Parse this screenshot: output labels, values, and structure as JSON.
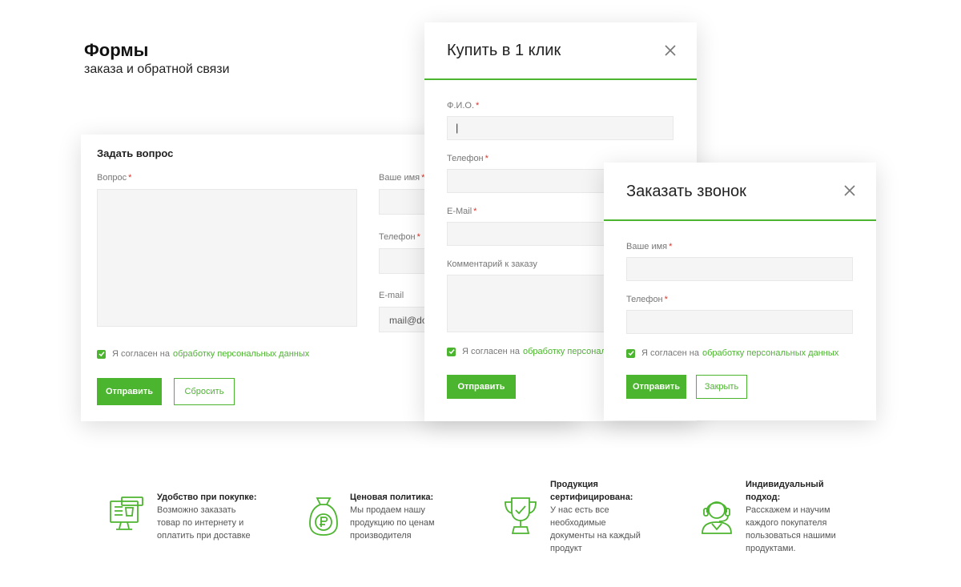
{
  "page": {
    "title": "Формы",
    "subtitle": "заказа и обратной связи"
  },
  "question_form": {
    "title": "Задать вопрос",
    "question_label": "Вопрос",
    "name_label": "Ваше имя",
    "phone_label": "Телефон",
    "email_label": "E-mail",
    "email_placeholder": "mail@do",
    "consent_text": "Я согласен на",
    "consent_link": "обработку персональных данных",
    "submit_label": "Отправить",
    "reset_label": "Сбросить"
  },
  "buy_modal": {
    "title": "Купить в 1 клик",
    "fio_label": "Ф.И.О.",
    "fio_value": "|",
    "phone_label": "Телефон",
    "email_label": "E-Mail",
    "comment_label": "Комментарий к заказу",
    "consent_text": "Я согласен на",
    "consent_link": "обработку персональ",
    "submit_label": "Отправить"
  },
  "call_modal": {
    "title": "Заказать звонок",
    "name_label": "Ваше имя",
    "phone_label": "Телефон",
    "consent_text": "Я согласен на",
    "consent_link": "обработку персональных данных",
    "submit_label": "Отправить",
    "close_label": "Закрыть"
  },
  "features": [
    {
      "icon": "computer-cart-icon",
      "title": "Удобство при покупке:",
      "text": [
        "Возможно заказать",
        "товар по интернету и",
        "оплатить при доставке"
      ]
    },
    {
      "icon": "money-bag-icon",
      "title": "Ценовая политика:",
      "text": [
        "Мы продаем нашу",
        "продукцию по ценам",
        "производителя"
      ]
    },
    {
      "icon": "trophy-icon",
      "title_lines": [
        "Продукция",
        "сертифицирована:"
      ],
      "text": [
        "У нас есть все",
        "необходимые",
        "документы на каждый",
        "продукт"
      ]
    },
    {
      "icon": "support-agent-icon",
      "title_lines": [
        "Индивидуальный",
        "подход:"
      ],
      "text": [
        "Расскажем и научим",
        "каждого покупателя",
        "пользоваться нашими",
        "продуктами."
      ]
    }
  ],
  "colors": {
    "accent": "#4cb52f",
    "required": "#d9342b",
    "field": "#f5f5f5"
  }
}
